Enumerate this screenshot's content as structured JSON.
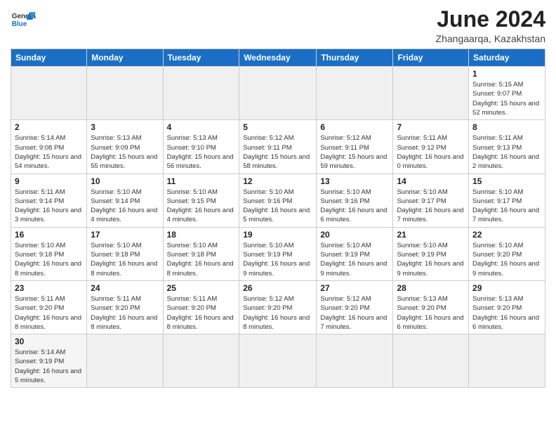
{
  "header": {
    "logo_general": "General",
    "logo_blue": "Blue",
    "title": "June 2024",
    "location": "Zhangaarqa, Kazakhstan"
  },
  "days_of_week": [
    "Sunday",
    "Monday",
    "Tuesday",
    "Wednesday",
    "Thursday",
    "Friday",
    "Saturday"
  ],
  "weeks": [
    [
      {
        "day": "",
        "empty": true
      },
      {
        "day": "",
        "empty": true
      },
      {
        "day": "",
        "empty": true
      },
      {
        "day": "",
        "empty": true
      },
      {
        "day": "",
        "empty": true
      },
      {
        "day": "",
        "empty": true
      },
      {
        "day": "1",
        "sunrise": "5:15 AM",
        "sunset": "9:07 PM",
        "daylight": "15 hours and 52 minutes."
      }
    ],
    [
      {
        "day": "2",
        "sunrise": "5:14 AM",
        "sunset": "9:08 PM",
        "daylight": "15 hours and 54 minutes."
      },
      {
        "day": "3",
        "sunrise": "5:13 AM",
        "sunset": "9:09 PM",
        "daylight": "15 hours and 55 minutes."
      },
      {
        "day": "4",
        "sunrise": "5:13 AM",
        "sunset": "9:10 PM",
        "daylight": "15 hours and 56 minutes."
      },
      {
        "day": "5",
        "sunrise": "5:12 AM",
        "sunset": "9:11 PM",
        "daylight": "15 hours and 58 minutes."
      },
      {
        "day": "6",
        "sunrise": "5:12 AM",
        "sunset": "9:11 PM",
        "daylight": "15 hours and 59 minutes."
      },
      {
        "day": "7",
        "sunrise": "5:11 AM",
        "sunset": "9:12 PM",
        "daylight": "16 hours and 0 minutes."
      },
      {
        "day": "8",
        "sunrise": "5:11 AM",
        "sunset": "9:13 PM",
        "daylight": "16 hours and 2 minutes."
      }
    ],
    [
      {
        "day": "9",
        "sunrise": "5:11 AM",
        "sunset": "9:14 PM",
        "daylight": "16 hours and 3 minutes."
      },
      {
        "day": "10",
        "sunrise": "5:10 AM",
        "sunset": "9:14 PM",
        "daylight": "16 hours and 4 minutes."
      },
      {
        "day": "11",
        "sunrise": "5:10 AM",
        "sunset": "9:15 PM",
        "daylight": "16 hours and 4 minutes."
      },
      {
        "day": "12",
        "sunrise": "5:10 AM",
        "sunset": "9:16 PM",
        "daylight": "16 hours and 5 minutes."
      },
      {
        "day": "13",
        "sunrise": "5:10 AM",
        "sunset": "9:16 PM",
        "daylight": "16 hours and 6 minutes."
      },
      {
        "day": "14",
        "sunrise": "5:10 AM",
        "sunset": "9:17 PM",
        "daylight": "16 hours and 7 minutes."
      },
      {
        "day": "15",
        "sunrise": "5:10 AM",
        "sunset": "9:17 PM",
        "daylight": "16 hours and 7 minutes."
      }
    ],
    [
      {
        "day": "16",
        "sunrise": "5:10 AM",
        "sunset": "9:18 PM",
        "daylight": "16 hours and 8 minutes."
      },
      {
        "day": "17",
        "sunrise": "5:10 AM",
        "sunset": "9:18 PM",
        "daylight": "16 hours and 8 minutes."
      },
      {
        "day": "18",
        "sunrise": "5:10 AM",
        "sunset": "9:18 PM",
        "daylight": "16 hours and 8 minutes."
      },
      {
        "day": "19",
        "sunrise": "5:10 AM",
        "sunset": "9:19 PM",
        "daylight": "16 hours and 9 minutes."
      },
      {
        "day": "20",
        "sunrise": "5:10 AM",
        "sunset": "9:19 PM",
        "daylight": "16 hours and 9 minutes."
      },
      {
        "day": "21",
        "sunrise": "5:10 AM",
        "sunset": "9:19 PM",
        "daylight": "16 hours and 9 minutes."
      },
      {
        "day": "22",
        "sunrise": "5:10 AM",
        "sunset": "9:20 PM",
        "daylight": "16 hours and 9 minutes."
      }
    ],
    [
      {
        "day": "23",
        "sunrise": "5:11 AM",
        "sunset": "9:20 PM",
        "daylight": "16 hours and 8 minutes."
      },
      {
        "day": "24",
        "sunrise": "5:11 AM",
        "sunset": "9:20 PM",
        "daylight": "16 hours and 8 minutes."
      },
      {
        "day": "25",
        "sunrise": "5:11 AM",
        "sunset": "9:20 PM",
        "daylight": "16 hours and 8 minutes."
      },
      {
        "day": "26",
        "sunrise": "5:12 AM",
        "sunset": "9:20 PM",
        "daylight": "16 hours and 8 minutes."
      },
      {
        "day": "27",
        "sunrise": "5:12 AM",
        "sunset": "9:20 PM",
        "daylight": "16 hours and 7 minutes."
      },
      {
        "day": "28",
        "sunrise": "5:13 AM",
        "sunset": "9:20 PM",
        "daylight": "16 hours and 6 minutes."
      },
      {
        "day": "29",
        "sunrise": "5:13 AM",
        "sunset": "9:20 PM",
        "daylight": "16 hours and 6 minutes."
      }
    ],
    [
      {
        "day": "30",
        "sunrise": "5:14 AM",
        "sunset": "9:19 PM",
        "daylight": "16 hours and 5 minutes."
      },
      {
        "day": "",
        "empty": true
      },
      {
        "day": "",
        "empty": true
      },
      {
        "day": "",
        "empty": true
      },
      {
        "day": "",
        "empty": true
      },
      {
        "day": "",
        "empty": true
      },
      {
        "day": "",
        "empty": true
      }
    ]
  ],
  "labels": {
    "sunrise": "Sunrise:",
    "sunset": "Sunset:",
    "daylight": "Daylight:"
  }
}
